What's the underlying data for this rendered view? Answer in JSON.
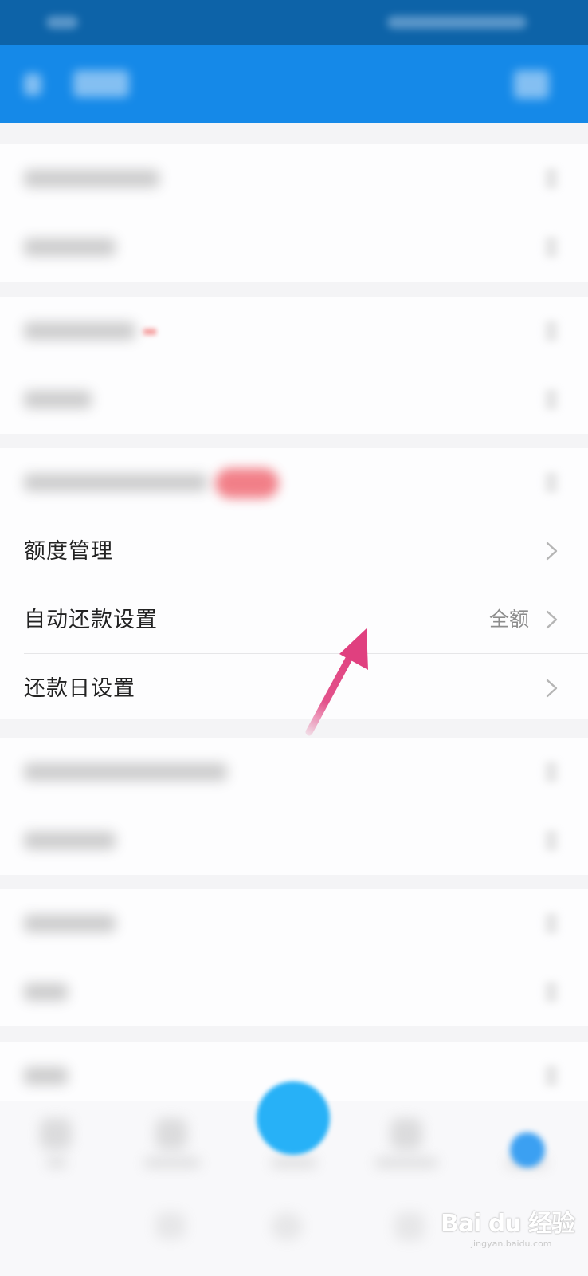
{
  "rows": {
    "quota": {
      "label": "额度管理"
    },
    "auto_repay": {
      "label": "自动还款设置",
      "value": "全额"
    },
    "repay_day": {
      "label": "还款日设置"
    }
  },
  "icons": {
    "chevron": "chevron-right-icon",
    "annotation": "arrow-up-right-annotation"
  },
  "colors": {
    "status_bar": "#0d63a8",
    "nav_bar": "#1589e8",
    "fab": "#27b1f7",
    "annotation_arrow": "#e0407f"
  },
  "watermark": {
    "brand": "Bai du 经验",
    "url": "jingyan.baidu.com"
  }
}
